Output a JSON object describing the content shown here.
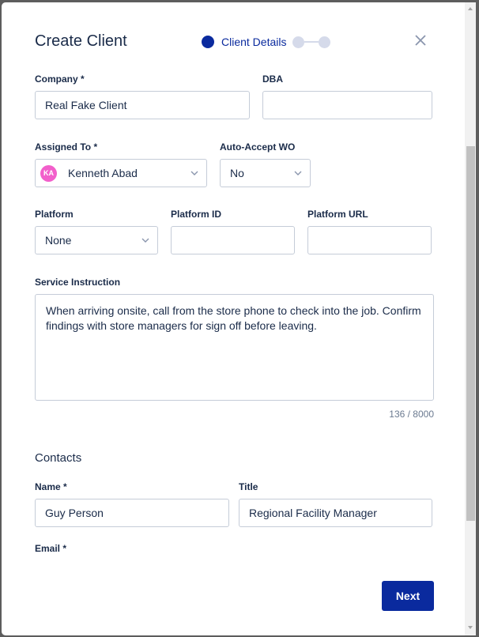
{
  "modal": {
    "title": "Create Client",
    "stepper": {
      "active_label": "Client Details",
      "total_steps": 3,
      "active_step": 1
    }
  },
  "fields": {
    "company": {
      "label": "Company",
      "required": true,
      "value": "Real Fake Client"
    },
    "dba": {
      "label": "DBA",
      "value": ""
    },
    "assigned_to": {
      "label": "Assigned To",
      "required": true,
      "avatar_initials": "KA",
      "avatar_color": "#f25fcb",
      "value": "Kenneth Abad"
    },
    "auto_accept_wo": {
      "label": "Auto-Accept WO",
      "value": "No"
    },
    "platform": {
      "label": "Platform",
      "value": "None"
    },
    "platform_id": {
      "label": "Platform ID",
      "value": ""
    },
    "platform_url": {
      "label": "Platform URL",
      "value": ""
    },
    "service_instruction": {
      "label": "Service Instruction",
      "value": "When arriving onsite, call from the store phone to check into the job. Confirm findings with store managers for sign off before leaving.",
      "counter": "136 / 8000"
    }
  },
  "contacts": {
    "heading": "Contacts",
    "name": {
      "label": "Name",
      "required": true,
      "value": "Guy Person"
    },
    "title": {
      "label": "Title",
      "value": "Regional Facility Manager"
    },
    "email": {
      "label": "Email",
      "required": true
    }
  },
  "actions": {
    "next_label": "Next"
  },
  "colors": {
    "primary": "#0a2a9e",
    "text": "#1a2b49",
    "border": "#c5ccd8",
    "step_inactive": "#d5daea"
  }
}
